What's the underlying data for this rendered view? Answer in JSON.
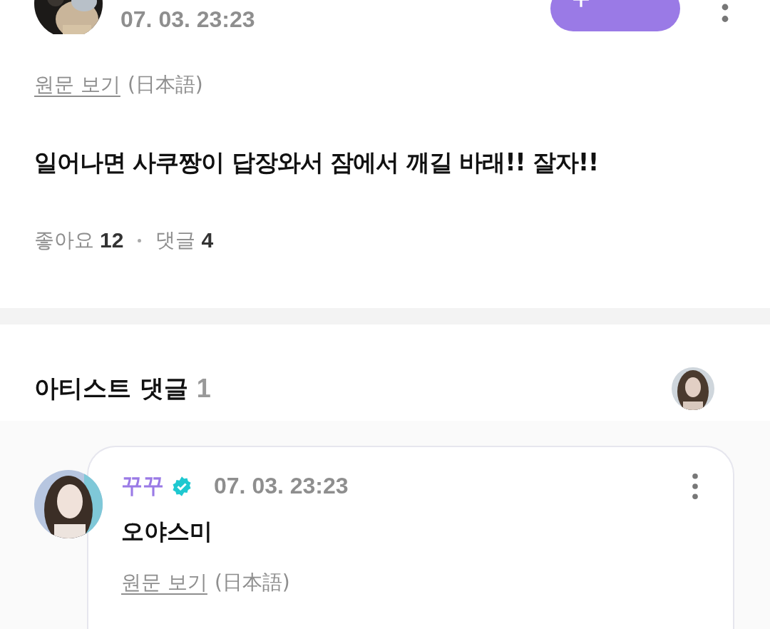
{
  "post": {
    "timestamp": "07. 03. 23:23",
    "original_link": "원문 보기",
    "original_language": "(日本語)",
    "body": "일어나면 사쿠짱이 답장와서 잠에서 깨길 바래!! 잘자!!",
    "likes_label": "좋아요",
    "likes_count": "12",
    "comments_label": "댓글",
    "comments_count": "4"
  },
  "artist_comments": {
    "title": "아티스트 댓글",
    "count": "1",
    "comments": [
      {
        "author": "꾸꾸",
        "verified": true,
        "timestamp": "07. 03. 23:23",
        "body": "오야스미",
        "original_link": "원문 보기",
        "original_language": "(日本語)"
      }
    ]
  }
}
